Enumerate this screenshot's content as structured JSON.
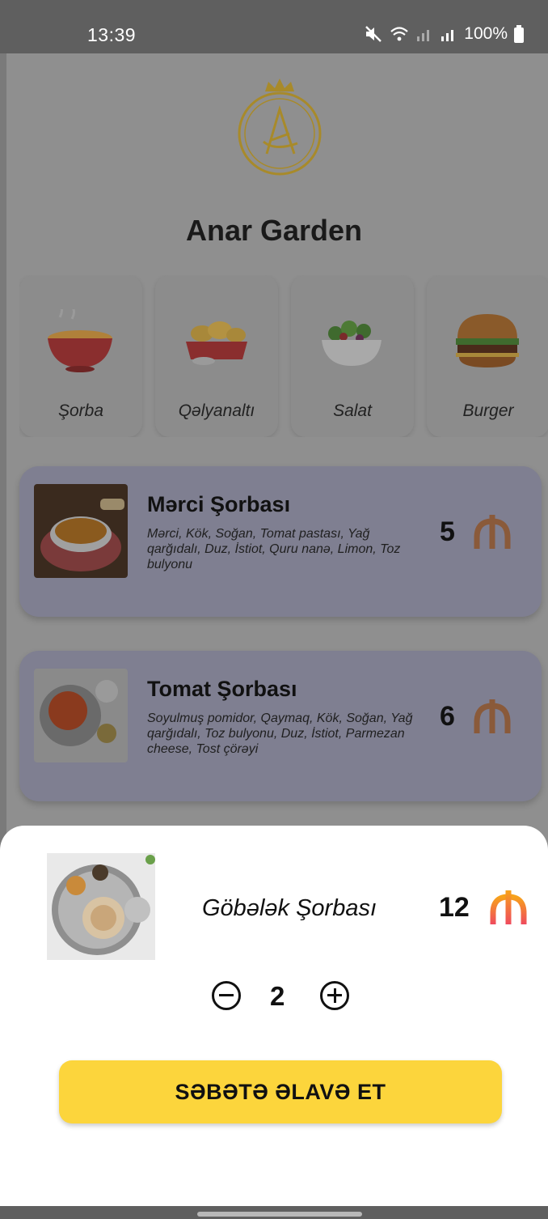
{
  "status_bar": {
    "time": "13:39",
    "battery": "100%",
    "icons": [
      "mute-icon",
      "wifi-icon",
      "signal-icon",
      "signal-icon",
      "battery-icon"
    ]
  },
  "brand": {
    "name": "Anar Garden",
    "logo_icon": "anar-logo-icon"
  },
  "categories": [
    {
      "label": "Şorba",
      "icon": "soup-bowl-icon"
    },
    {
      "label": "Qəlyanaltı",
      "icon": "nuggets-icon"
    },
    {
      "label": "Salat",
      "icon": "salad-icon"
    },
    {
      "label": "Burger",
      "icon": "burger-icon"
    }
  ],
  "menu_items": [
    {
      "name": "Mərci Şorbası",
      "description": "Mərci, Kök, Soğan, Tomat pastası, Yağ qarğıdalı, Duz, İstiot, Quru nanə, Limon, Toz bulyonu",
      "price": "5"
    },
    {
      "name": "Tomat Şorbası",
      "description": "Soyulmuş pomidor, Qaymaq, Kök, Soğan, Yağ qarğıdalı, Toz bulyonu, Duz, İstiot, Parmezan cheese, Tost çörəyi",
      "price": "6"
    }
  ],
  "sheet": {
    "name": "Göbələk Şorbası",
    "price": "12",
    "quantity": "2",
    "add_label": "SƏBƏTƏ ƏLAVƏ ET",
    "currency_icon": "manat-icon"
  },
  "colors": {
    "accent": "#fcd53c",
    "manat_gradient_top": "#f7a21b",
    "manat_gradient_bottom": "#ef4a5e",
    "scrim": "#7a7a7a"
  }
}
